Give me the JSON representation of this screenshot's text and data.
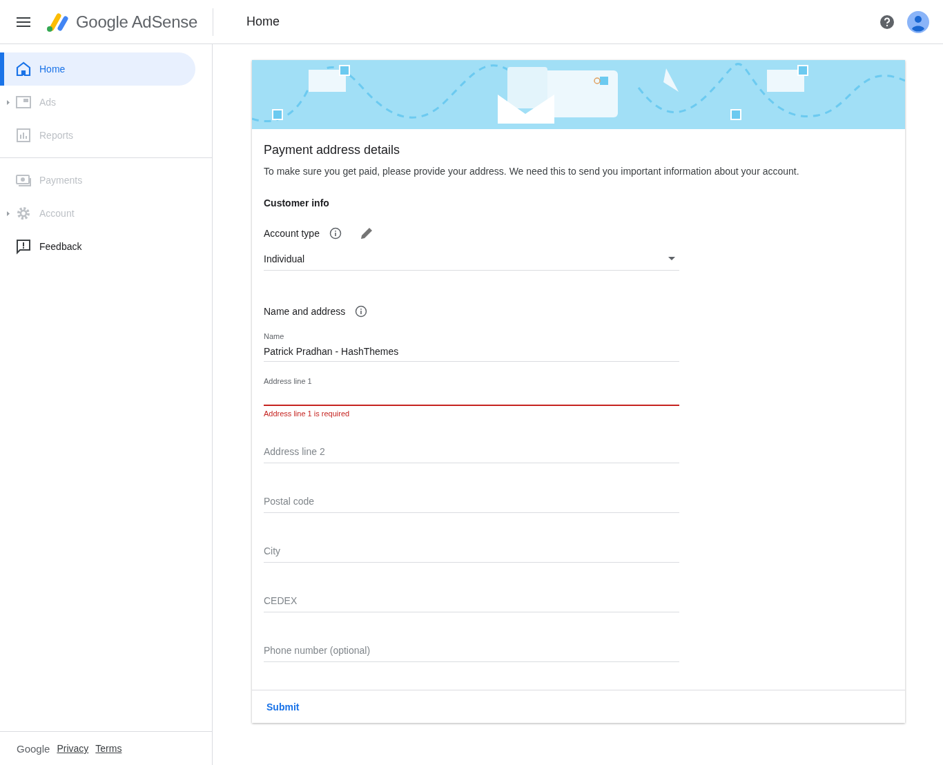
{
  "header": {
    "brand": "Google AdSense",
    "page_title": "Home"
  },
  "sidebar": {
    "sections": [
      {
        "items": [
          {
            "label": "Home",
            "kind": "home",
            "selected": true,
            "disabled": false,
            "expandable": false
          },
          {
            "label": "Ads",
            "kind": "ads",
            "selected": false,
            "disabled": true,
            "expandable": true
          },
          {
            "label": "Reports",
            "kind": "reports",
            "selected": false,
            "disabled": true,
            "expandable": false
          }
        ]
      },
      {
        "items": [
          {
            "label": "Payments",
            "kind": "payments",
            "selected": false,
            "disabled": true,
            "expandable": false
          },
          {
            "label": "Account",
            "kind": "account",
            "selected": false,
            "disabled": true,
            "expandable": true
          },
          {
            "label": "Feedback",
            "kind": "feedback",
            "selected": false,
            "disabled": false,
            "expandable": false
          }
        ]
      }
    ],
    "footer": {
      "brand": "Google",
      "links": [
        "Privacy",
        "Terms"
      ]
    }
  },
  "card": {
    "title": "Payment address details",
    "description": "To make sure you get paid, please provide your address. We need this to send you important information about your account.",
    "section_heading": "Customer info",
    "account_type": {
      "label": "Account type",
      "value": "Individual"
    },
    "name_address": {
      "label": "Name and address",
      "fields": [
        {
          "kind": "filled",
          "label": "Name",
          "value": "Patrick Pradhan - HashThemes"
        },
        {
          "kind": "error",
          "label": "Address line 1",
          "error": "Address line 1 is required"
        },
        {
          "kind": "empty",
          "placeholder": "Address line 2"
        },
        {
          "kind": "empty",
          "placeholder": "Postal code"
        },
        {
          "kind": "empty",
          "placeholder": "City"
        },
        {
          "kind": "empty",
          "placeholder": "CEDEX"
        },
        {
          "kind": "empty",
          "placeholder": "Phone number (optional)"
        }
      ]
    },
    "submit": "Submit"
  }
}
